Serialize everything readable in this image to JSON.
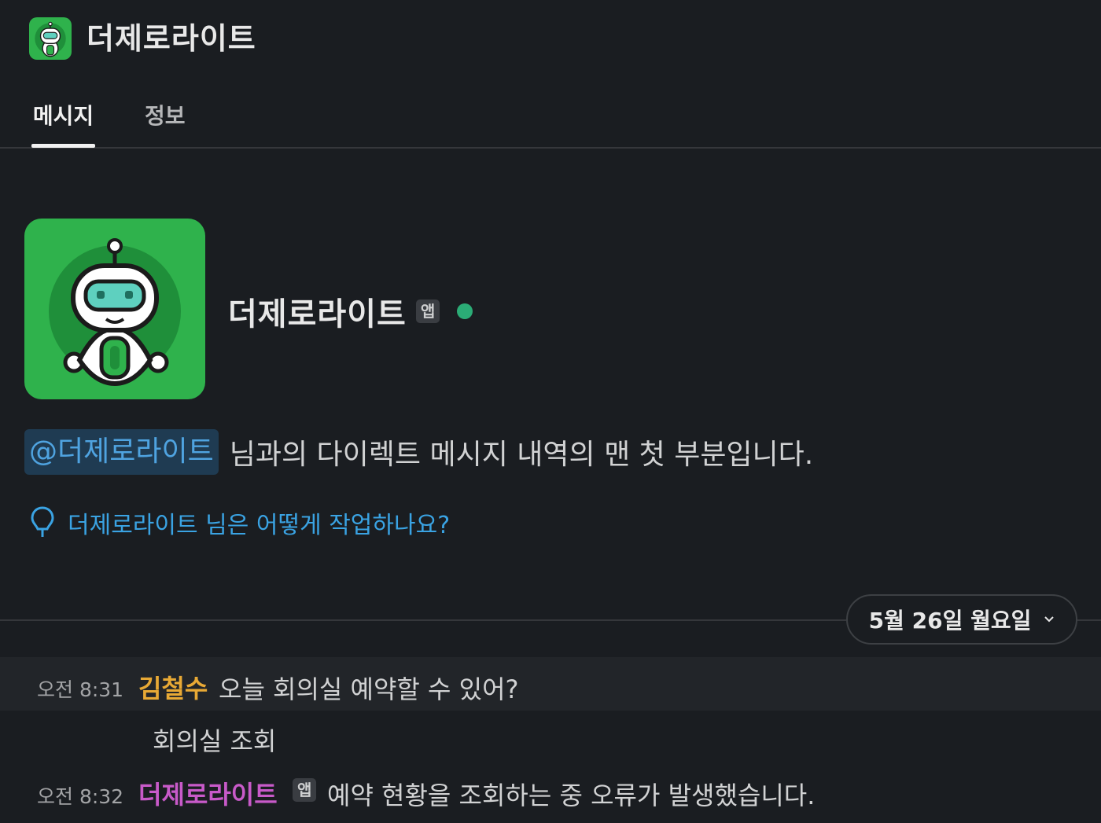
{
  "header": {
    "title": "더제로라이트",
    "avatar_icon": "robot-icon"
  },
  "tabs": [
    {
      "label": "메시지",
      "active": true
    },
    {
      "label": "정보",
      "active": false
    }
  ],
  "intro": {
    "name": "더제로라이트",
    "badge": "앱",
    "presence": "online",
    "mention": "@더제로라이트",
    "text": "님과의 다이렉트 메시지 내역의 맨 첫 부분입니다.",
    "howto": "더제로라이트 님은 어떻게 작업하나요?"
  },
  "date_divider": {
    "label": "5월 26일 월요일"
  },
  "messages": [
    {
      "time": "오전 8:31",
      "sender": "김철수",
      "text": "오늘 회의실 예약할 수 있어?"
    },
    {
      "text": "회의실 조회"
    },
    {
      "time": "오전 8:32",
      "sender": "더제로라이트",
      "badge": "앱",
      "text": "예약 현황을 조회하는 중 오류가 발생했습니다."
    }
  ],
  "colors": {
    "background": "#1a1d21",
    "brand_green": "#2fb24c",
    "link_blue": "#3aa3e3",
    "presence_green": "#2bac76",
    "sender_user": "#e8a935",
    "sender_bot": "#c85ac9"
  }
}
